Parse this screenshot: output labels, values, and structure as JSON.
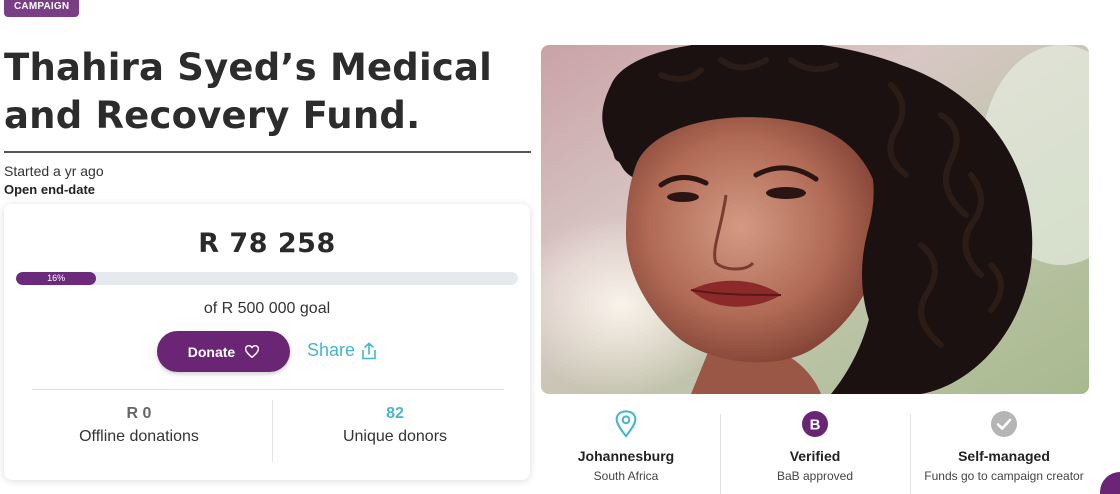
{
  "tag": "CAMPAIGN",
  "title": "Thahira Syed’s Medical and Recovery Fund.",
  "started": "Started a yr ago",
  "end_date": "Open end-date",
  "donation": {
    "amount": "R 78 258",
    "progress_label": "16%",
    "progress_fraction": 0.16,
    "goal": "of R 500 000 goal",
    "donate_label": "Donate",
    "share_label": "Share",
    "stats": [
      {
        "value": "R 0",
        "label": "Offline donations"
      },
      {
        "value": "82",
        "label": "Unique donors"
      }
    ]
  },
  "info": [
    {
      "icon": "location-pin-icon",
      "title": "Johannesburg",
      "subtitle": "South Africa"
    },
    {
      "icon": "bab-badge-icon",
      "badge_letter": "B",
      "title": "Verified",
      "subtitle": "BaB approved"
    },
    {
      "icon": "check-circle-icon",
      "title": "Self-managed",
      "subtitle": "Funds go to campaign creator"
    }
  ],
  "colors": {
    "brand_purple": "#6a2574",
    "accent_teal": "#45b4cf",
    "track_grey": "#e6e9ee"
  }
}
